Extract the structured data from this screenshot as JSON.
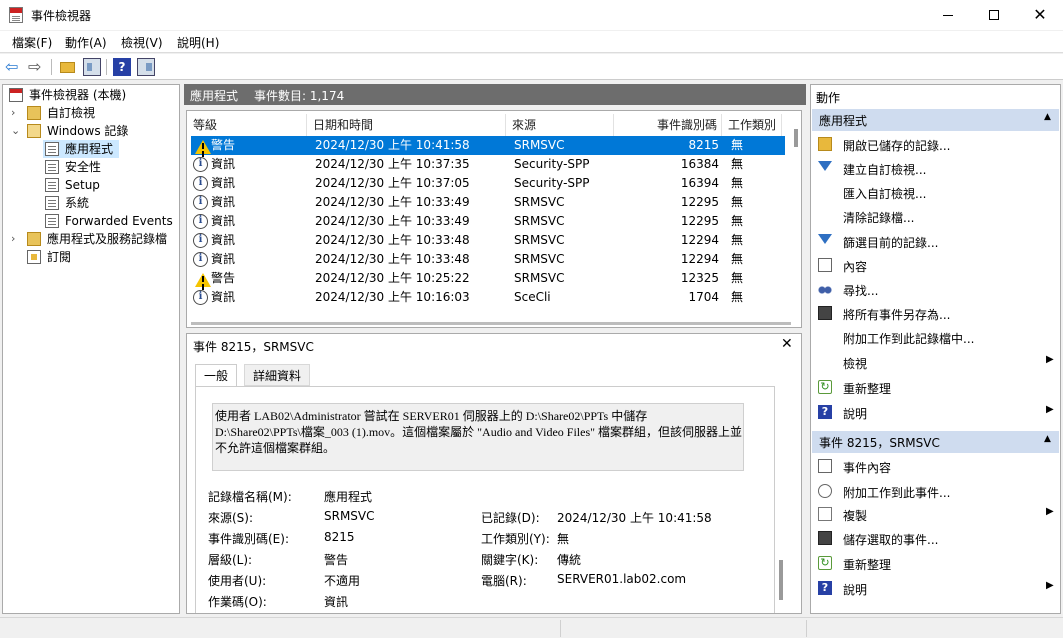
{
  "window": {
    "title": "事件檢視器",
    "minimize_glyph": "",
    "maximize_glyph": "",
    "close_glyph": "✕"
  },
  "menu": [
    {
      "label": "檔案(F)"
    },
    {
      "label": "動作(A)"
    },
    {
      "label": "檢視(V)"
    },
    {
      "label": "說明(H)"
    }
  ],
  "toolbar": {
    "back_glyph": "⇦",
    "forward_glyph": "⇨",
    "help_glyph": "?"
  },
  "tree": [
    {
      "label": "事件檢視器 (本機)",
      "icon": "event-viewer-icon",
      "expander": ""
    },
    {
      "label": "自訂檢視",
      "icon": "folder-icon",
      "expander": "›"
    },
    {
      "label": "Windows 記錄",
      "icon": "folder-open-icon",
      "expander": "⌄"
    },
    {
      "label": "應用程式",
      "icon": "log-icon",
      "expander": ""
    },
    {
      "label": "安全性",
      "icon": "log-icon",
      "expander": ""
    },
    {
      "label": "Setup",
      "icon": "log-icon",
      "expander": ""
    },
    {
      "label": "系統",
      "icon": "log-icon",
      "expander": ""
    },
    {
      "label": "Forwarded Events",
      "icon": "log-icon",
      "expander": ""
    },
    {
      "label": "應用程式及服務記錄檔",
      "icon": "folder-icon",
      "expander": "›"
    },
    {
      "label": "訂閱",
      "icon": "subscription-icon",
      "expander": ""
    }
  ],
  "center": {
    "log_name": "應用程式",
    "event_count": "事件數目: 1,174"
  },
  "list": {
    "headers": [
      "等級",
      "日期和時間",
      "來源",
      "事件識別碼",
      "工作類別"
    ],
    "rows": [
      {
        "level": "警告",
        "icon": "warning-icon",
        "datetime": "2024/12/30 上午 10:41:58",
        "source": "SRMSVC",
        "id": "8215",
        "task": "無"
      },
      {
        "level": "資訊",
        "icon": "info-icon",
        "datetime": "2024/12/30 上午 10:37:35",
        "source": "Security-SPP",
        "id": "16384",
        "task": "無"
      },
      {
        "level": "資訊",
        "icon": "info-icon",
        "datetime": "2024/12/30 上午 10:37:05",
        "source": "Security-SPP",
        "id": "16394",
        "task": "無"
      },
      {
        "level": "資訊",
        "icon": "info-icon",
        "datetime": "2024/12/30 上午 10:33:49",
        "source": "SRMSVC",
        "id": "12295",
        "task": "無"
      },
      {
        "level": "資訊",
        "icon": "info-icon",
        "datetime": "2024/12/30 上午 10:33:49",
        "source": "SRMSVC",
        "id": "12295",
        "task": "無"
      },
      {
        "level": "資訊",
        "icon": "info-icon",
        "datetime": "2024/12/30 上午 10:33:48",
        "source": "SRMSVC",
        "id": "12294",
        "task": "無"
      },
      {
        "level": "資訊",
        "icon": "info-icon",
        "datetime": "2024/12/30 上午 10:33:48",
        "source": "SRMSVC",
        "id": "12294",
        "task": "無"
      },
      {
        "level": "警告",
        "icon": "warning-icon",
        "datetime": "2024/12/30 上午 10:25:22",
        "source": "SRMSVC",
        "id": "12325",
        "task": "無"
      },
      {
        "level": "資訊",
        "icon": "info-icon",
        "datetime": "2024/12/30 上午 10:16:03",
        "source": "SceCli",
        "id": "1704",
        "task": "無"
      }
    ]
  },
  "detail": {
    "title": "事件 8215，SRMSVC",
    "close_glyph": "✕",
    "tabs": [
      "一般",
      "詳細資料"
    ],
    "description": "使用者 LAB02\\Administrator 嘗試在 SERVER01 伺服器上的 D:\\Share02\\PPTs 中儲存 D:\\Share02\\PPTs\\檔案_003 (1).mov。這個檔案屬於 \"Audio and Video Files\" 檔案群組，但該伺服器上並不允許這個檔案群組。",
    "fields": {
      "log_name_label": "記錄檔名稱(M):",
      "log_name": "應用程式",
      "source_label": "來源(S):",
      "source": "SRMSVC",
      "logged_label": "已記錄(D):",
      "logged": "2024/12/30 上午 10:41:58",
      "event_id_label": "事件識別碼(E):",
      "event_id": "8215",
      "task_label": "工作類別(Y):",
      "task": "無",
      "level_label": "層級(L):",
      "level": "警告",
      "keywords_label": "關鍵字(K):",
      "keywords": "傳統",
      "user_label": "使用者(U):",
      "user": "不適用",
      "computer_label": "電腦(R):",
      "computer": "SERVER01.lab02.com",
      "opcode_label": "作業碼(O):",
      "opcode": "資訊"
    }
  },
  "actions": {
    "title": "動作",
    "section1": {
      "title": "應用程式",
      "collapse_glyph": "▲",
      "items": [
        {
          "label": "開啟已儲存的記錄...",
          "icon": "open-log-icon"
        },
        {
          "label": "建立自訂檢視...",
          "icon": "create-view-icon"
        },
        {
          "label": "匯入自訂檢視...",
          "icon": ""
        },
        {
          "label": "清除記錄檔...",
          "icon": ""
        },
        {
          "label": "篩選目前的記錄...",
          "icon": "filter-icon"
        },
        {
          "label": "內容",
          "icon": "properties-icon"
        },
        {
          "label": "尋找...",
          "icon": "find-icon"
        },
        {
          "label": "將所有事件另存為...",
          "icon": "save-icon"
        },
        {
          "label": "附加工作到此記錄檔中...",
          "icon": ""
        },
        {
          "label": "檢視",
          "icon": "",
          "arrow": "▶"
        },
        {
          "label": "重新整理",
          "icon": "refresh-icon"
        },
        {
          "label": "說明",
          "icon": "help-icon",
          "arrow": "▶"
        }
      ]
    },
    "section2": {
      "title": "事件 8215，SRMSVC",
      "collapse_glyph": "▲",
      "items": [
        {
          "label": "事件內容",
          "icon": "event-properties-icon"
        },
        {
          "label": "附加工作到此事件...",
          "icon": "attach-task-icon"
        },
        {
          "label": "複製",
          "icon": "copy-icon",
          "arrow": "▶"
        },
        {
          "label": "儲存選取的事件...",
          "icon": "save-icon"
        },
        {
          "label": "重新整理",
          "icon": "refresh-icon"
        },
        {
          "label": "說明",
          "icon": "help-icon",
          "arrow": "▶"
        }
      ]
    }
  },
  "colors": {
    "selection": "#0078d7",
    "header_bar": "#6d6d6d",
    "section_header": "#cfdcef"
  }
}
